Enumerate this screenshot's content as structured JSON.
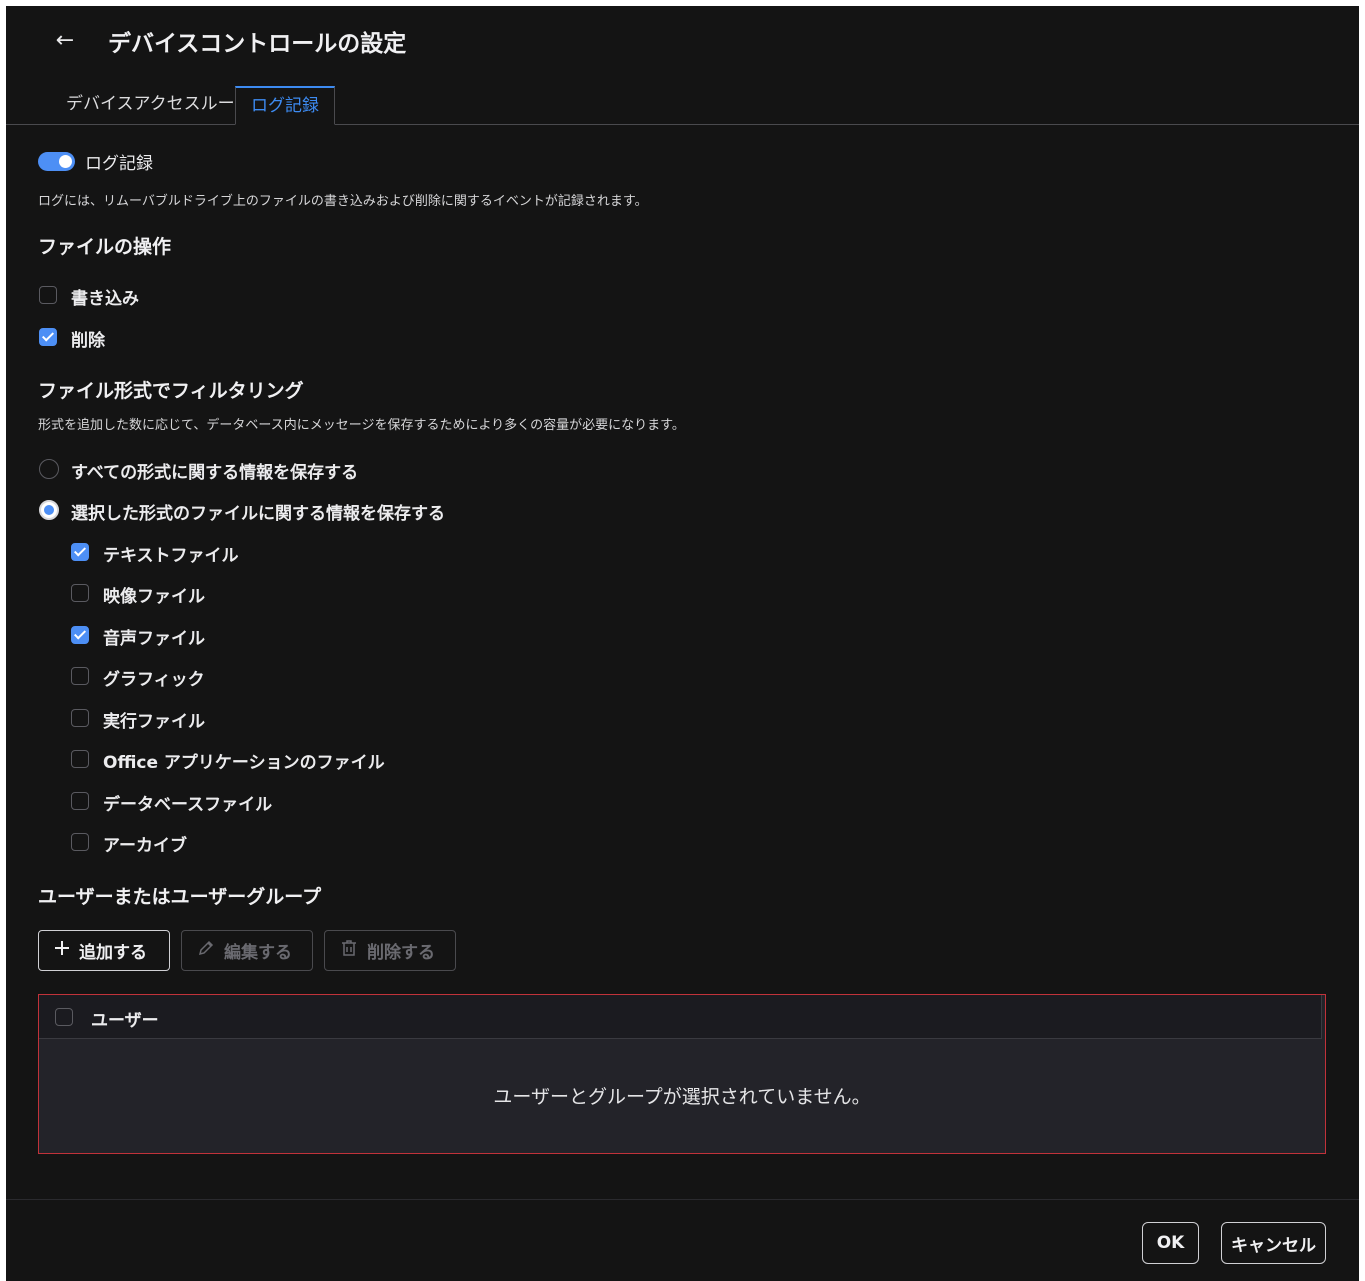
{
  "window": {
    "title": "デバイスコントロールの設定",
    "back_icon": "←"
  },
  "tabs": [
    {
      "label": "デバイスアクセスルール",
      "active": false
    },
    {
      "label": "ログ記録",
      "active": true
    }
  ],
  "logging": {
    "toggle_label": "ログ記録",
    "toggle_on": true,
    "description": "ログには、リムーバブルドライブ上のファイルの書き込みおよび削除に関するイベントが記録されます。"
  },
  "file_ops": {
    "heading": "ファイルの操作",
    "options": [
      {
        "label": "書き込み",
        "checked": false
      },
      {
        "label": "削除",
        "checked": true
      }
    ]
  },
  "filter": {
    "heading": "ファイル形式でフィルタリング",
    "description": "形式を追加した数に応じて、データベース内にメッセージを保存するためにより多くの容量が必要になります。",
    "radios": [
      {
        "label": "すべての形式に関する情報を保存する",
        "selected": false
      },
      {
        "label": "選択した形式のファイルに関する情報を保存する",
        "selected": true
      }
    ],
    "types": [
      {
        "label": "テキストファイル",
        "checked": true
      },
      {
        "label": "映像ファイル",
        "checked": false
      },
      {
        "label": "音声ファイル",
        "checked": true
      },
      {
        "label": "グラフィック",
        "checked": false
      },
      {
        "label": "実行ファイル",
        "checked": false
      },
      {
        "label": "Office アプリケーションのファイル",
        "checked": false
      },
      {
        "label": "データベースファイル",
        "checked": false
      },
      {
        "label": "アーカイブ",
        "checked": false
      }
    ]
  },
  "users": {
    "heading": "ユーザーまたはユーザーグループ",
    "add_label": "追加する",
    "edit_label": "編集する",
    "delete_label": "削除する",
    "column_header": "ユーザー",
    "empty_message": "ユーザーとグループが選択されていません。"
  },
  "footer": {
    "ok_label": "OK",
    "cancel_label": "キャンセル"
  },
  "colors": {
    "accent": "#4d8ff5",
    "background": "#141414",
    "table_border": "#c1323a"
  }
}
